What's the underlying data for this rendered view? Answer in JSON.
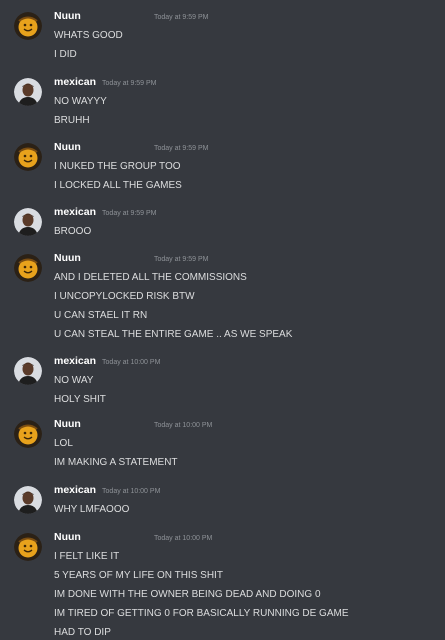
{
  "groups": [
    {
      "user": "Nuun",
      "timestamp": "Today at 9:59 PM",
      "avatar": "smiley-avatar",
      "lines": [
        "WHATS GOOD",
        "I DID"
      ]
    },
    {
      "user": "mexican",
      "timestamp": "Today at 9:59 PM",
      "avatar": "man-avatar",
      "lines": [
        "NO WAYYY",
        "BRUHH"
      ]
    },
    {
      "user": "Nuun",
      "timestamp": "Today at 9:59 PM",
      "avatar": "smiley-avatar",
      "lines": [
        "I NUKED THE GROUP TOO",
        "I LOCKED ALL THE GAMES"
      ]
    },
    {
      "user": "mexican",
      "timestamp": "Today at 9:59 PM",
      "avatar": "man-avatar",
      "lines": [
        "BROOO"
      ]
    },
    {
      "user": "Nuun",
      "timestamp": "Today at 9:59 PM",
      "avatar": "smiley-avatar",
      "lines": [
        "AND I DELETED ALL THE COMMISSIONS",
        "I UNCOPYLOCKED RISK BTW",
        "U CAN STAEL IT RN",
        "U CAN STEAL THE ENTIRE GAME .. AS WE SPEAK"
      ]
    },
    {
      "user": "mexican",
      "timestamp": "Today at 10:00 PM",
      "avatar": "man-avatar",
      "lines": [
        "NO WAY",
        "HOLY SHIT"
      ]
    },
    {
      "user": "Nuun",
      "timestamp": "Today at 10:00 PM",
      "avatar": "smiley-avatar",
      "lines": [
        "LOL",
        "IM MAKING A STATEMENT"
      ]
    },
    {
      "user": "mexican",
      "timestamp": "Today at 10:00 PM",
      "avatar": "man-avatar",
      "lines": [
        "WHY LMFAOOO"
      ]
    },
    {
      "user": "Nuun",
      "timestamp": "Today at 10:00 PM",
      "avatar": "smiley-avatar",
      "lines": [
        "I FELT LIKE IT",
        "5 YEARS OF MY LIFE ON THIS SHIT",
        "IM DONE WITH THE OWNER BEING DEAD AND DOING 0",
        "IM TIRED OF GETTING 0 FOR BASICALLY RUNNING DE GAME",
        "HAD TO DIP"
      ]
    }
  ]
}
